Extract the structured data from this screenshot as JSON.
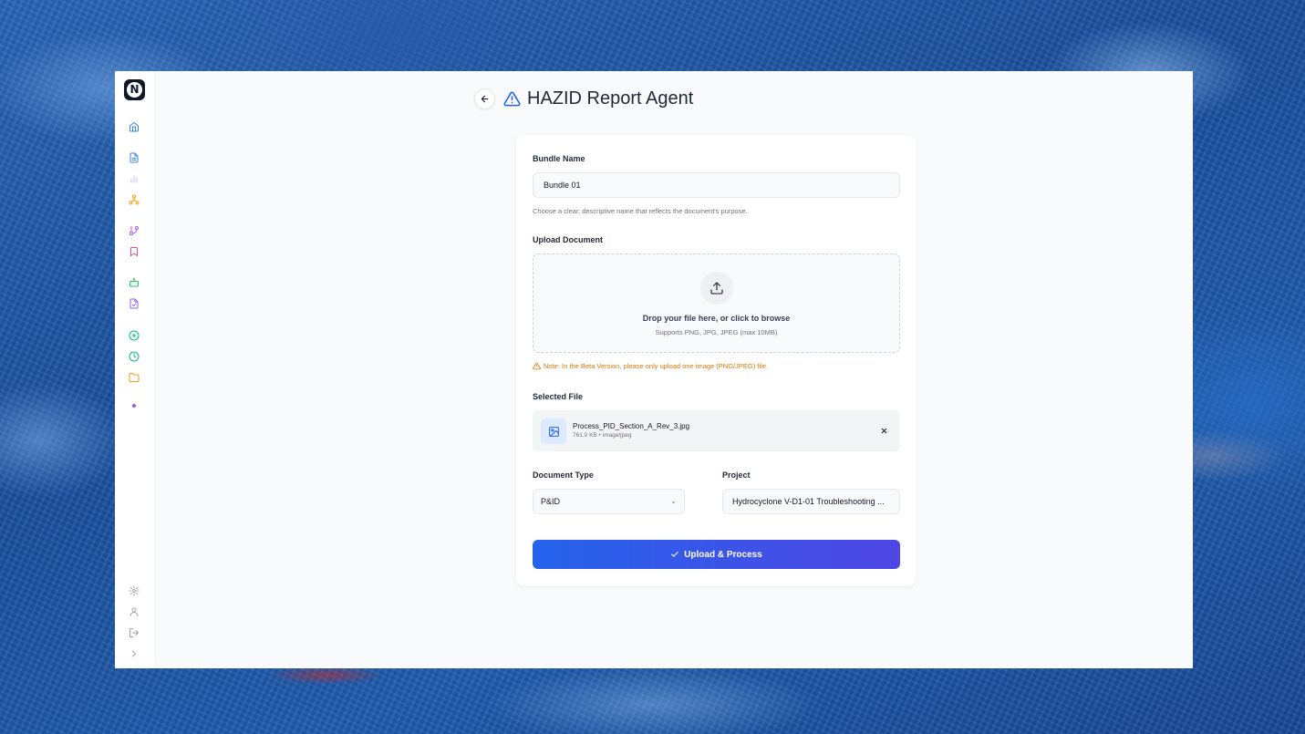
{
  "app": {
    "logo_letter": "N",
    "title": "HAZID Report Agent"
  },
  "sidebar": {
    "top_items": [
      {
        "icon": "home-icon",
        "color": "#3b82f6"
      },
      {
        "icon": "document-icon",
        "color": "#3b82f6"
      },
      {
        "icon": "bar-chart-icon",
        "color": "#c4b5fd"
      },
      {
        "icon": "network-icon",
        "color": "#f59e0b"
      },
      {
        "icon": "git-branch-icon",
        "color": "#a855f7"
      },
      {
        "icon": "bookmark-icon",
        "color": "#ec4899"
      },
      {
        "icon": "bot-icon",
        "color": "#22c55e"
      },
      {
        "icon": "file-check-icon",
        "color": "#8b5cf6"
      },
      {
        "icon": "plus-circle-icon",
        "color": "#10b981"
      },
      {
        "icon": "clock-icon",
        "color": "#10b981"
      },
      {
        "icon": "folder-icon",
        "color": "#f59e0b"
      },
      {
        "icon": "dot-icon",
        "color": "#8b5cf6"
      }
    ],
    "bottom_items": [
      {
        "icon": "settings-icon",
        "color": "#9ca3af"
      },
      {
        "icon": "user-icon",
        "color": "#9ca3af"
      },
      {
        "icon": "logout-icon",
        "color": "#9ca3af"
      },
      {
        "icon": "chevron-right-icon",
        "color": "#9ca3af"
      }
    ]
  },
  "form": {
    "bundle_name_label": "Bundle Name",
    "bundle_name_value": "Bundle 01",
    "bundle_name_helper": "Choose a clear, descriptive name that reflects the document's purpose.",
    "upload_label": "Upload Document",
    "drop_title": "Drop your file here, or click to browse",
    "drop_subtitle": "Supports PNG, JPG, JPEG (max 10MB)",
    "beta_note": "Note: In the Beta Version, please only upload one image (PNG/JPEG) file.",
    "selected_file_label": "Selected File",
    "selected_file": {
      "name": "Process_PID_Section_A_Rev_3.jpg",
      "meta": "761.0 KB • image/jpeg"
    },
    "document_type_label": "Document Type",
    "document_type_value": "P&ID",
    "project_label": "Project",
    "project_value": "Hydrocyclone V-D1-01 Troubleshooting ...",
    "submit_label": "Upload & Process"
  },
  "colors": {
    "accent": "#2563eb",
    "accent_end": "#4f46e5",
    "warning": "#d97706",
    "title_icon": "#2563eb"
  }
}
